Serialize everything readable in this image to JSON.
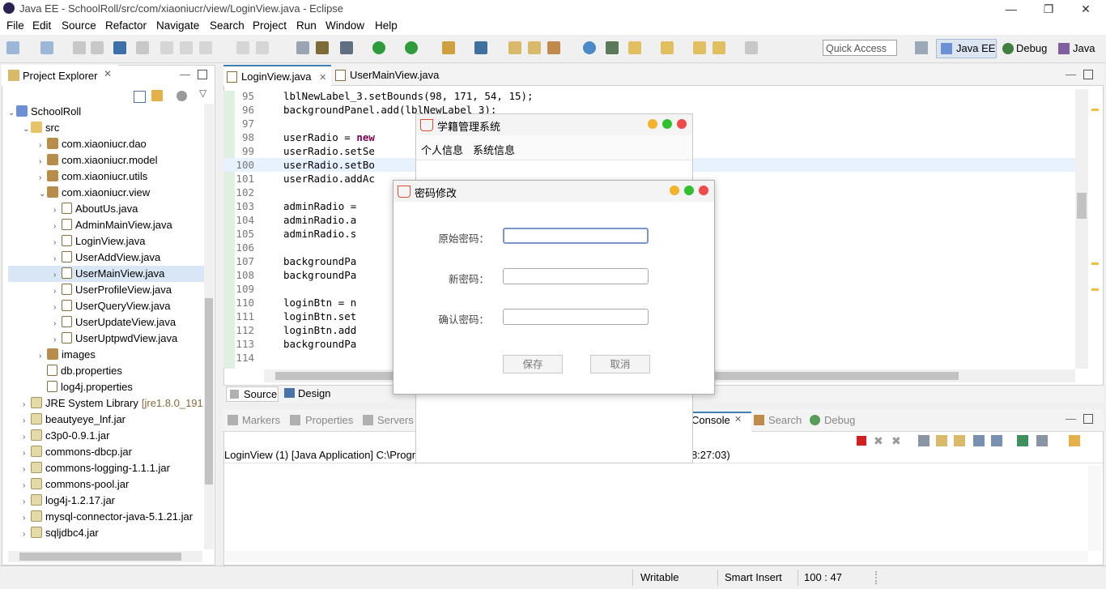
{
  "window": {
    "title": "Java EE - SchoolRoll/src/com/xiaoniucr/view/LoginView.java - Eclipse",
    "minimize": "—",
    "restore": "❐",
    "close": "✕"
  },
  "menu": [
    "File",
    "Edit",
    "Source",
    "Refactor",
    "Navigate",
    "Search",
    "Project",
    "Run",
    "Window",
    "Help"
  ],
  "toolbar": {
    "quick_access": "Quick Access",
    "perspectives": [
      "Java EE",
      "Debug",
      "Java"
    ]
  },
  "project_explorer": {
    "title": "Project Explorer",
    "items": [
      {
        "label": "SchoolRoll",
        "arrow": "⌄",
        "icon": "proj"
      },
      {
        "label": "src",
        "arrow": "⌄",
        "icon": "fold"
      },
      {
        "label": "com.xiaoniucr.dao",
        "arrow": "›",
        "icon": "pkg"
      },
      {
        "label": "com.xiaoniucr.model",
        "arrow": "›",
        "icon": "pkg"
      },
      {
        "label": "com.xiaoniucr.utils",
        "arrow": "›",
        "icon": "pkg"
      },
      {
        "label": "com.xiaoniucr.view",
        "arrow": "⌄",
        "icon": "pkg"
      },
      {
        "label": "AboutUs.java",
        "arrow": "›",
        "icon": "java"
      },
      {
        "label": "AdminMainView.java",
        "arrow": "›",
        "icon": "java"
      },
      {
        "label": "LoginView.java",
        "arrow": "›",
        "icon": "java"
      },
      {
        "label": "UserAddView.java",
        "arrow": "›",
        "icon": "java"
      },
      {
        "label": "UserMainView.java",
        "arrow": "›",
        "icon": "java"
      },
      {
        "label": "UserProfileView.java",
        "arrow": "›",
        "icon": "java"
      },
      {
        "label": "UserQueryView.java",
        "arrow": "›",
        "icon": "java"
      },
      {
        "label": "UserUpdateView.java",
        "arrow": "›",
        "icon": "java"
      },
      {
        "label": "UserUptpwdView.java",
        "arrow": "›",
        "icon": "java"
      },
      {
        "label": "images",
        "arrow": "›",
        "icon": "pkg"
      },
      {
        "label": "db.properties",
        "arrow": "",
        "icon": "java"
      },
      {
        "label": "log4j.properties",
        "arrow": "",
        "icon": "java"
      },
      {
        "label": "JRE System Library",
        "arrow": "›",
        "icon": "jar",
        "extra": "[jre1.8.0_191"
      },
      {
        "label": "beautyeye_lnf.jar",
        "arrow": "›",
        "icon": "jar"
      },
      {
        "label": "c3p0-0.9.1.jar",
        "arrow": "›",
        "icon": "jar"
      },
      {
        "label": "commons-dbcp.jar",
        "arrow": "›",
        "icon": "jar"
      },
      {
        "label": "commons-logging-1.1.1.jar",
        "arrow": "›",
        "icon": "jar"
      },
      {
        "label": "commons-pool.jar",
        "arrow": "›",
        "icon": "jar"
      },
      {
        "label": "log4j-1.2.17.jar",
        "arrow": "›",
        "icon": "jar"
      },
      {
        "label": "mysql-connector-java-5.1.21.jar",
        "arrow": "›",
        "icon": "jar"
      },
      {
        "label": "sqljdbc4.jar",
        "arrow": "›",
        "icon": "jar"
      }
    ],
    "selected_index": 10
  },
  "editor": {
    "tabs": [
      "LoginView.java",
      "UserMainView.java"
    ],
    "lines": [
      {
        "n": "95",
        "code": "lblNewLabel_3.setBounds(98, 171, 54, 15);"
      },
      {
        "n": "96",
        "code": "backgroundPanel.add(lblNewLabel_3);"
      },
      {
        "n": "97",
        "code": ""
      },
      {
        "n": "98",
        "code": "userRadio = new"
      },
      {
        "n": "99",
        "code": "userRadio.setSe"
      },
      {
        "n": "100",
        "code": "userRadio.setBo"
      },
      {
        "n": "101",
        "code": "userRadio.addAc"
      },
      {
        "n": "102",
        "code": ""
      },
      {
        "n": "103",
        "code": "adminRadio ="
      },
      {
        "n": "104",
        "code": "adminRadio.a"
      },
      {
        "n": "105",
        "code": "adminRadio.s"
      },
      {
        "n": "106",
        "code": ""
      },
      {
        "n": "107",
        "code": "backgroundPa"
      },
      {
        "n": "108",
        "code": "backgroundPa"
      },
      {
        "n": "109",
        "code": ""
      },
      {
        "n": "110",
        "code": "loginBtn = n"
      },
      {
        "n": "111",
        "code": "loginBtn.set"
      },
      {
        "n": "112",
        "code": "loginBtn.add"
      },
      {
        "n": "113",
        "code": "backgroundPa"
      },
      {
        "n": "114",
        "code": ""
      }
    ],
    "bottom_tabs": [
      "Source",
      "Design"
    ]
  },
  "main_dialog": {
    "title": "学籍管理系统",
    "menu": [
      "个人信息",
      "系统信息"
    ]
  },
  "pwd_dialog": {
    "title": "密码修改",
    "labels": [
      "原始密码：",
      "新密码：",
      "确认密码："
    ],
    "save": "保存",
    "cancel": "取消"
  },
  "console": {
    "tabs": [
      "Markers",
      "Properties",
      "Servers",
      "Console",
      "Search",
      "Debug"
    ],
    "status_line": "LoginView (1) [Java Application] C:\\Program Files\\Java\\jre1.8.0_191\\bin\\javaw.exe (2021年3月4日 下午8:27:03)",
    "status_visible_left": "LoginView (1) [Java Application] C:\\Progr",
    "status_visible_right": "F8:27:03)"
  },
  "statusbar": {
    "writable": "Writable",
    "insert": "Smart Insert",
    "position": "100 : 47"
  },
  "colors": {
    "accent": "#3c7fb1",
    "selection": "#d9e6f5",
    "dot_yellow": "#f5b22c",
    "dot_green": "#30c030",
    "dot_red": "#f04a4a"
  }
}
